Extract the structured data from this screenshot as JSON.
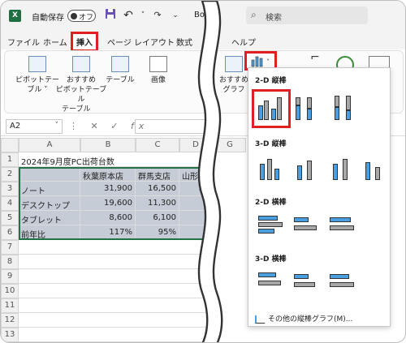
{
  "titlebar": {
    "app_icon": "X",
    "autosave_label": "自動保存",
    "toggle_label": "オフ",
    "title": "Bo",
    "search_placeholder": "検索",
    "icons": [
      "save-icon",
      "undo-icon",
      "dropdown-icon"
    ]
  },
  "tabs": [
    {
      "label": "ファイル"
    },
    {
      "label": "ホーム"
    },
    {
      "label": "挿入",
      "active": true
    },
    {
      "label": "ページ レイアウト"
    },
    {
      "label": "数式"
    },
    {
      "label": "ヘルプ"
    }
  ],
  "ribbon": {
    "pivot_line1": "ピボットテー",
    "pivot_line2": "ブル ˅",
    "recommended_pivot_line1": "おすすめ",
    "recommended_pivot_line2": "ピボットテーブル",
    "table": "テーブル",
    "image": "画像",
    "recommended_chart_line1": "おすすめ",
    "recommended_chart_line2": "グラフ",
    "group_label": "テーブル"
  },
  "formula_bar": {
    "name_box": "A2",
    "fx": "fx"
  },
  "grid": {
    "columns": [
      "A",
      "B",
      "C",
      "D"
    ],
    "rows": [
      "1",
      "2",
      "3",
      "4",
      "5",
      "6",
      "7",
      "8",
      "9",
      "10",
      "11",
      "12",
      "13",
      "14"
    ],
    "title": "2024年9月度PC出荷台数",
    "headers": [
      "",
      "秋葉原本店",
      "群馬支店",
      "山形支"
    ],
    "data": [
      [
        "ノート",
        "31,900",
        "16,500",
        "10"
      ],
      [
        "デスクトップ",
        "19,600",
        "11,300",
        ""
      ],
      [
        "タブレット",
        "8,600",
        "6,100",
        ""
      ],
      [
        "前年比",
        "117%",
        "95%",
        ""
      ]
    ],
    "selected_col_g": "G"
  },
  "dropdown": {
    "sec1": "2-D 縦棒",
    "sec2": "3-D 縦棒",
    "sec3": "2-D 横棒",
    "sec4": "3-D 横棒",
    "more": "その他の縦棒グラフ(M)..."
  },
  "colors": {
    "accent_red": "#e02020",
    "bar_blue": "#4a9fe0",
    "bar_gray": "#a8a8a8",
    "excel_green": "#1d6f42"
  }
}
